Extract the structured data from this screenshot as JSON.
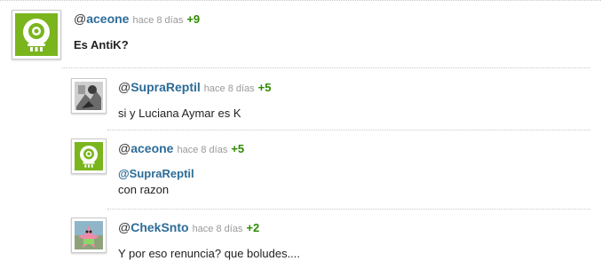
{
  "comments": [
    {
      "user": "aceone",
      "time": "hace 8 días",
      "votes": "+9",
      "text": "Es AntiK?",
      "avatar": "green-cyclops-avatar"
    },
    {
      "user": "SupraReptil",
      "time": "hace 8 días",
      "votes": "+5",
      "text": "si y Luciana Aymar es K",
      "avatar": "grayscale-photo-avatar"
    },
    {
      "user": "aceone",
      "time": "hace 8 días",
      "votes": "+5",
      "mention": "@SupraReptil",
      "text": "con razon",
      "avatar": "green-cyclops-avatar"
    },
    {
      "user": "ChekSnto",
      "time": "hace 8 días",
      "votes": "+2",
      "text": "Y por eso renuncia? que boludes....",
      "avatar": "patrick-star-avatar"
    }
  ],
  "colors": {
    "username": "#2c6c98",
    "votes": "#2e8b00",
    "timestamp": "#999999",
    "avatar_green": "#7ab51d"
  }
}
